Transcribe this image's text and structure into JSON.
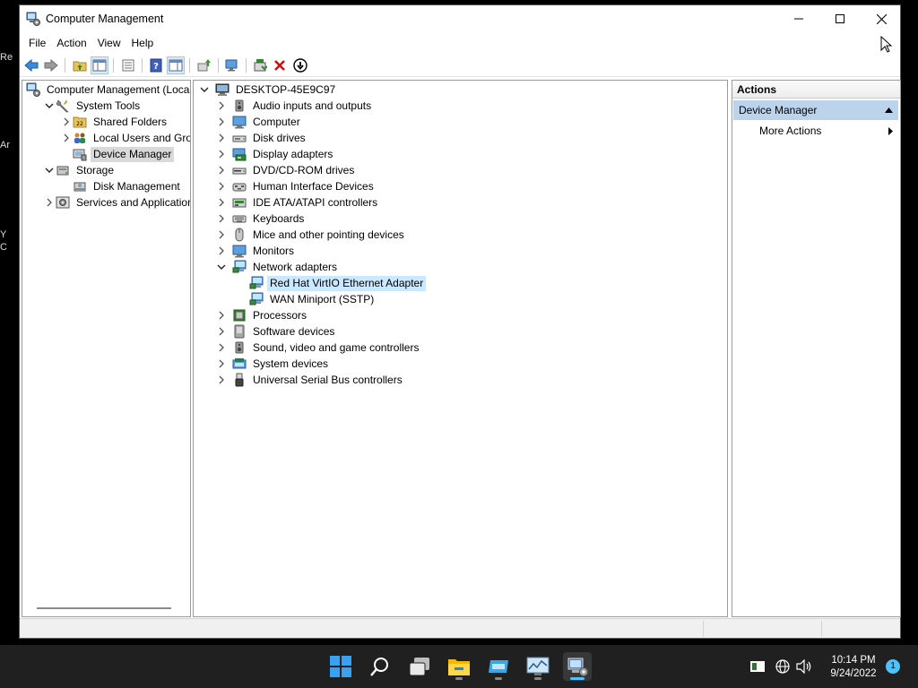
{
  "window": {
    "title": "Computer Management",
    "menu": [
      "File",
      "Action",
      "View",
      "Help"
    ]
  },
  "nav_tree": [
    {
      "label": "Computer Management (Local",
      "depth": 0,
      "expander": "none",
      "icon": "computer-management-icon"
    },
    {
      "label": "System Tools",
      "depth": 1,
      "expander": "expanded",
      "icon": "system-tools-icon"
    },
    {
      "label": "Shared Folders",
      "depth": 2,
      "expander": "collapsed",
      "icon": "shared-folders-icon"
    },
    {
      "label": "Local Users and Groups",
      "depth": 2,
      "expander": "collapsed",
      "icon": "users-icon"
    },
    {
      "label": "Device Manager",
      "depth": 2,
      "expander": "none",
      "icon": "device-manager-icon",
      "selected": true
    },
    {
      "label": "Storage",
      "depth": 1,
      "expander": "expanded",
      "icon": "storage-icon"
    },
    {
      "label": "Disk Management",
      "depth": 2,
      "expander": "none",
      "icon": "disk-management-icon"
    },
    {
      "label": "Services and Applications",
      "depth": 1,
      "expander": "collapsed",
      "icon": "services-icon"
    }
  ],
  "device_tree": {
    "root": "DESKTOP-45E9C97",
    "categories": [
      {
        "label": "Audio inputs and outputs",
        "icon": "speaker-icon"
      },
      {
        "label": "Computer",
        "icon": "computer-icon"
      },
      {
        "label": "Disk drives",
        "icon": "disk-drive-icon"
      },
      {
        "label": "Display adapters",
        "icon": "display-adapter-icon"
      },
      {
        "label": "DVD/CD-ROM drives",
        "icon": "dvd-drive-icon"
      },
      {
        "label": "Human Interface Devices",
        "icon": "hid-icon"
      },
      {
        "label": "IDE ATA/ATAPI controllers",
        "icon": "ide-controller-icon"
      },
      {
        "label": "Keyboards",
        "icon": "keyboard-icon"
      },
      {
        "label": "Mice and other pointing devices",
        "icon": "mouse-icon"
      },
      {
        "label": "Monitors",
        "icon": "monitor-icon"
      },
      {
        "label": "Network adapters",
        "icon": "network-adapter-icon",
        "expanded": true,
        "children": [
          {
            "label": "Red Hat VirtIO Ethernet Adapter",
            "icon": "network-adapter-icon",
            "selected": true
          },
          {
            "label": "WAN Miniport (SSTP)",
            "icon": "network-adapter-icon"
          }
        ]
      },
      {
        "label": "Processors",
        "icon": "processor-icon"
      },
      {
        "label": "Software devices",
        "icon": "software-device-icon"
      },
      {
        "label": "Sound, video and game controllers",
        "icon": "speaker-icon"
      },
      {
        "label": "System devices",
        "icon": "system-device-icon"
      },
      {
        "label": "Universal Serial Bus controllers",
        "icon": "usb-icon"
      }
    ]
  },
  "actions": {
    "header": "Actions",
    "section": "Device Manager",
    "more": "More Actions"
  },
  "taskbar": {
    "clock_time": "10:14 PM",
    "clock_date": "9/24/2022",
    "notification_count": "1"
  },
  "desktop_fragments": [
    "Re",
    "Ar",
    "Y",
    "C"
  ],
  "colors": {
    "selection_blue": "#cce8ff",
    "selection_gray": "#d9d9d9",
    "actions_selected": "#bcd3ec",
    "taskbar": "#202020",
    "accent": "#0078d4"
  }
}
